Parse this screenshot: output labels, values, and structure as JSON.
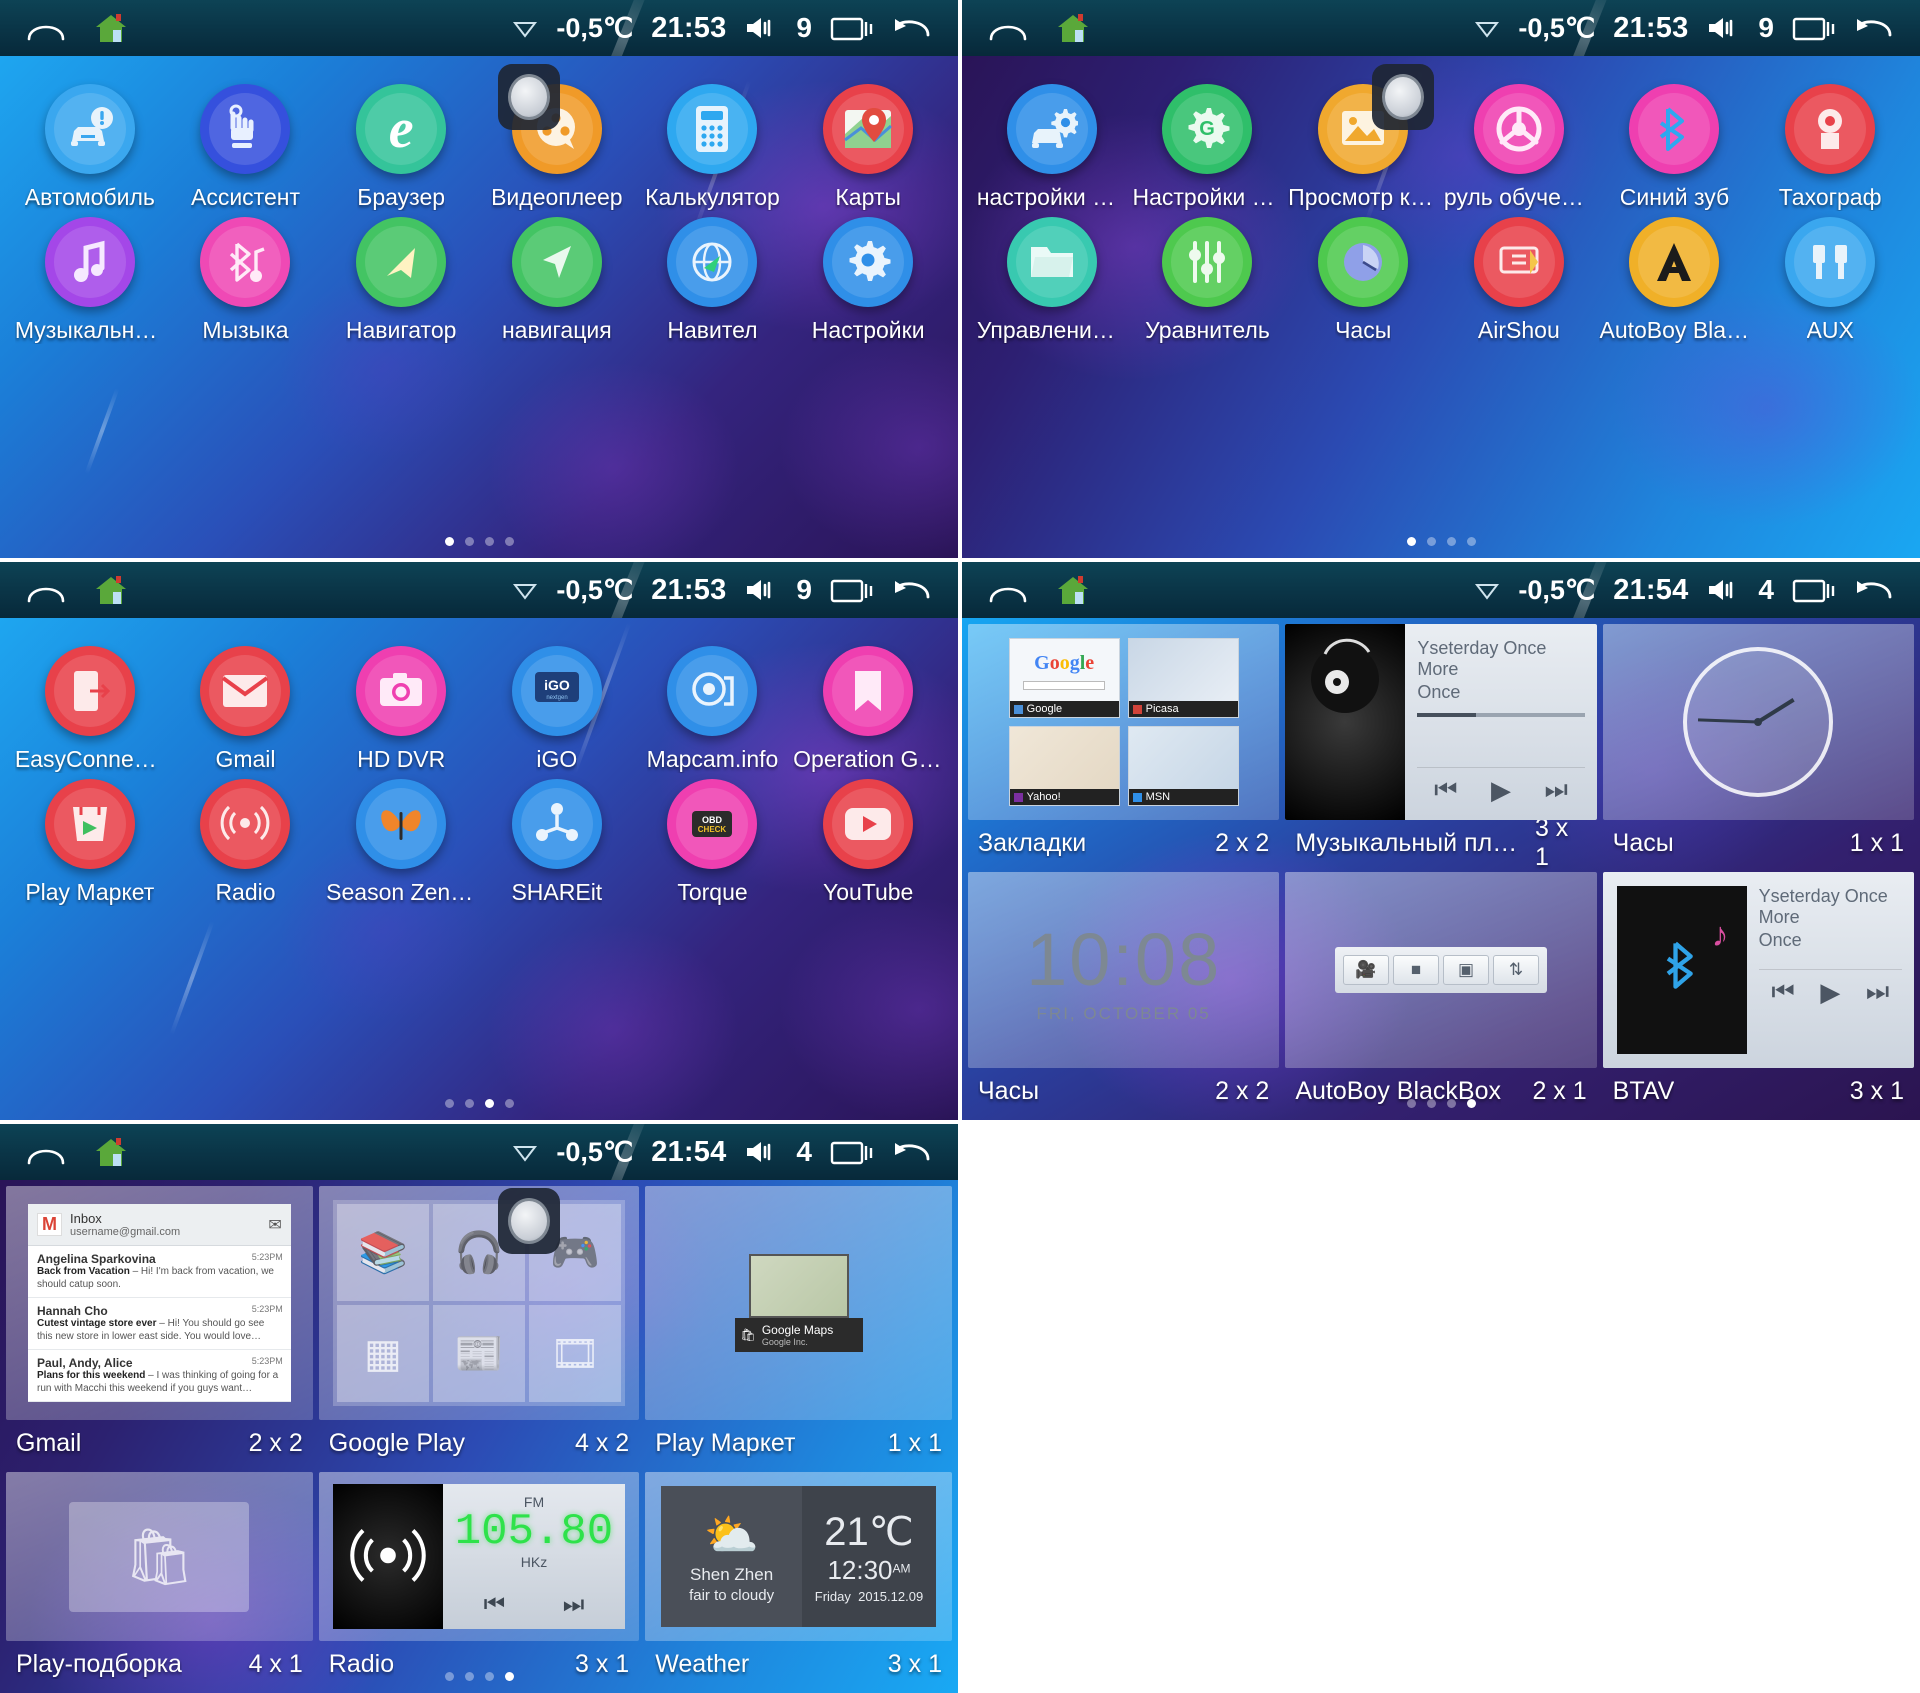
{
  "statusbar": {
    "temperature": "-0,5℃",
    "time_1": "21:53",
    "time_2": "21:54",
    "volume_9": "9",
    "volume_4": "4",
    "icons": [
      "back-arch-icon",
      "home-house-icon",
      "wifi-off-icon",
      "volume-icon",
      "recents-icon",
      "back-icon"
    ]
  },
  "panels": [
    {
      "id": "app-drawer-page-1",
      "type": "app-drawer",
      "time": "21:53",
      "volume": "9",
      "page_count": 4,
      "active_page": 1,
      "apps": [
        {
          "label": "Автомобиль",
          "icon": "car-warning-icon",
          "color": "#3aa7ef"
        },
        {
          "label": "Ассистент",
          "icon": "hand-touch-icon",
          "color": "#3550dd"
        },
        {
          "label": "Браузер",
          "icon": "ie-browser-icon",
          "color": "#34c49a"
        },
        {
          "label": "Видеоплеер",
          "icon": "film-reel-icon",
          "color": "#f09a28"
        },
        {
          "label": "Калькулятор",
          "icon": "calculator-icon",
          "color": "#2ea8f0"
        },
        {
          "label": "Карты",
          "icon": "google-maps-icon",
          "color": "#e8414a"
        },
        {
          "label": "Музыкальны…",
          "icon": "music-note-icon",
          "color": "#a447e8"
        },
        {
          "label": "Мызыка",
          "icon": "bluetooth-music-icon",
          "color": "#ef49b5"
        },
        {
          "label": "Навигатор",
          "icon": "navigation-arrow-icon",
          "color": "#43c463"
        },
        {
          "label": "навигация",
          "icon": "navigation-cursor-icon",
          "color": "#43c463"
        },
        {
          "label": "Навител",
          "icon": "globe-compass-icon",
          "color": "#2f8fe8"
        },
        {
          "label": "Настройки",
          "icon": "gear-icon",
          "color": "#2f8fe8"
        }
      ]
    },
    {
      "id": "app-drawer-page-2",
      "type": "app-drawer",
      "time": "21:53",
      "volume": "9",
      "page_count": 4,
      "active_page": 1,
      "apps": [
        {
          "label": "настройки ав…",
          "icon": "car-settings-icon",
          "color": "#2f8fe8"
        },
        {
          "label": "Настройки Go…",
          "icon": "google-settings-icon",
          "color": "#2fbf6a"
        },
        {
          "label": "Просмотр кар…",
          "icon": "gallery-image-icon",
          "color": "#f0a82e"
        },
        {
          "label": "руль обучения",
          "icon": "steering-wheel-icon",
          "color": "#ef3fb0"
        },
        {
          "label": "Синий зуб",
          "icon": "bluetooth-icon",
          "color": "#ef3fb0"
        },
        {
          "label": "Тахограф",
          "icon": "tachograph-icon",
          "color": "#e8414a"
        },
        {
          "label": "Управление д…",
          "icon": "folder-icon",
          "color": "#38c9b0"
        },
        {
          "label": "Уравнитель",
          "icon": "equalizer-icon",
          "color": "#4ec94e"
        },
        {
          "label": "Часы",
          "icon": "clock-icon",
          "color": "#4ec94e"
        },
        {
          "label": "AirShou",
          "icon": "airshou-icon",
          "color": "#e8414a"
        },
        {
          "label": "AutoBoy Black…",
          "icon": "autoboy-icon",
          "color": "#f0b028"
        },
        {
          "label": "AUX",
          "icon": "aux-plug-icon",
          "color": "#3aa7ef"
        }
      ]
    },
    {
      "id": "app-drawer-page-3",
      "type": "app-drawer",
      "time": "21:53",
      "volume": "9",
      "page_count": 4,
      "active_page": 3,
      "apps": [
        {
          "label": "EasyConnected",
          "icon": "easyconnected-icon",
          "color": "#e8414a"
        },
        {
          "label": "Gmail",
          "icon": "gmail-icon",
          "color": "#e8414a"
        },
        {
          "label": "HD DVR",
          "icon": "camera-icon",
          "color": "#ef3fb0"
        },
        {
          "label": "iGO",
          "icon": "igo-icon",
          "color": "#2f8fe8"
        },
        {
          "label": "Mapcam.info",
          "icon": "mapcam-icon",
          "color": "#2f8fe8"
        },
        {
          "label": "Operation Gui…",
          "icon": "bookmark-icon",
          "color": "#ef3fb0"
        },
        {
          "label": "Play Маркет",
          "icon": "play-store-icon",
          "color": "#e8414a"
        },
        {
          "label": "Radio",
          "icon": "radio-tower-icon",
          "color": "#e8414a"
        },
        {
          "label": "Season Zen HD",
          "icon": "butterfly-icon",
          "color": "#2f8fe8"
        },
        {
          "label": "SHAREit",
          "icon": "shareit-icon",
          "color": "#2f8fe8"
        },
        {
          "label": "Torque",
          "icon": "obd-check-icon",
          "color": "#ef3fb0"
        },
        {
          "label": "YouTube",
          "icon": "youtube-icon",
          "color": "#e8414a"
        }
      ]
    },
    {
      "id": "widget-picker-page-1",
      "type": "widget-picker",
      "time": "21:54",
      "volume": "4",
      "page_count": 4,
      "active_page": 4,
      "widgets": [
        {
          "name": "Закладки",
          "size": "2 x 2",
          "preview": "bookmarks"
        },
        {
          "name": "Музыкальный плеер",
          "size": "3 x 1",
          "preview": "music-player"
        },
        {
          "name": "Часы",
          "size": "1 x 1",
          "preview": "analog-clock"
        },
        {
          "name": "Часы",
          "size": "2 x 2",
          "preview": "digital-clock"
        },
        {
          "name": "AutoBoy BlackBox",
          "size": "2 x 1",
          "preview": "autoboy-bar"
        },
        {
          "name": "BTAV",
          "size": "3 x 1",
          "preview": "btav"
        }
      ]
    },
    {
      "id": "widget-picker-page-2",
      "type": "widget-picker",
      "time": "21:54",
      "volume": "4",
      "page_count": 4,
      "active_page": 4,
      "widgets": [
        {
          "name": "Gmail",
          "size": "2 x 2",
          "preview": "gmail"
        },
        {
          "name": "Google Play",
          "size": "4 x 2",
          "preview": "google-play"
        },
        {
          "name": "Play Маркет",
          "size": "1 x 1",
          "preview": "play-market"
        },
        {
          "name": "Play-подборка",
          "size": "4 x 1",
          "preview": "play-collection"
        },
        {
          "name": "Radio",
          "size": "3 x 1",
          "preview": "radio"
        },
        {
          "name": "Weather",
          "size": "3 x 1",
          "preview": "weather"
        }
      ]
    }
  ],
  "previews": {
    "bookmarks": {
      "items": [
        {
          "title": "Google",
          "logo_text": "Google"
        },
        {
          "title": "Picasa",
          "logo_text": "Picasa"
        },
        {
          "title": "Yahoo!",
          "logo_text": "Yahoo!"
        },
        {
          "title": "MSN",
          "logo_text": "MSN"
        }
      ]
    },
    "music_player": {
      "line1": "Yseterday Once More",
      "line2": "Once"
    },
    "digital_clock": {
      "time": "10:08",
      "date": "FRI, OCTOBER 05"
    },
    "btav": {
      "line1": "Yseterday Once More",
      "line2": "Once"
    },
    "gmail": {
      "inbox_label": "Inbox",
      "account": "username@gmail.com",
      "messages": [
        {
          "sender": "Angelina Sparkovina",
          "subject": "Back from Vacation",
          "snippet": "– Hi! I'm back from vacation, we should catup soon.",
          "time": "5:23PM"
        },
        {
          "sender": "Hannah Cho",
          "subject": "Cutest vintage store ever",
          "snippet": "– Hi! You should go see this new store in lower east side. You would love…",
          "time": "5:23PM"
        },
        {
          "sender": "Paul, Andy, Alice",
          "subject": "Plans for this weekend",
          "snippet": "– I was thinking of going for a run with Macchi this weekend if you guys want…",
          "time": "5:23PM"
        }
      ]
    },
    "play_market": {
      "title": "Google Maps",
      "subtitle": "Google Inc."
    },
    "radio": {
      "band": "FM",
      "frequency": "105.80",
      "unit": "HKz"
    },
    "weather": {
      "city": "Shen Zhen",
      "condition": "fair to cloudy",
      "temperature": "21℃",
      "time": "12:30",
      "ampm": "AM",
      "day": "Friday",
      "date": "2015.12.09"
    }
  },
  "colors": {
    "statusbar_bg": "#0a3446",
    "drawer_blue": "#1ea6f0",
    "drawer_purple": "#2a1457",
    "accent_green": "#2ee24a"
  }
}
